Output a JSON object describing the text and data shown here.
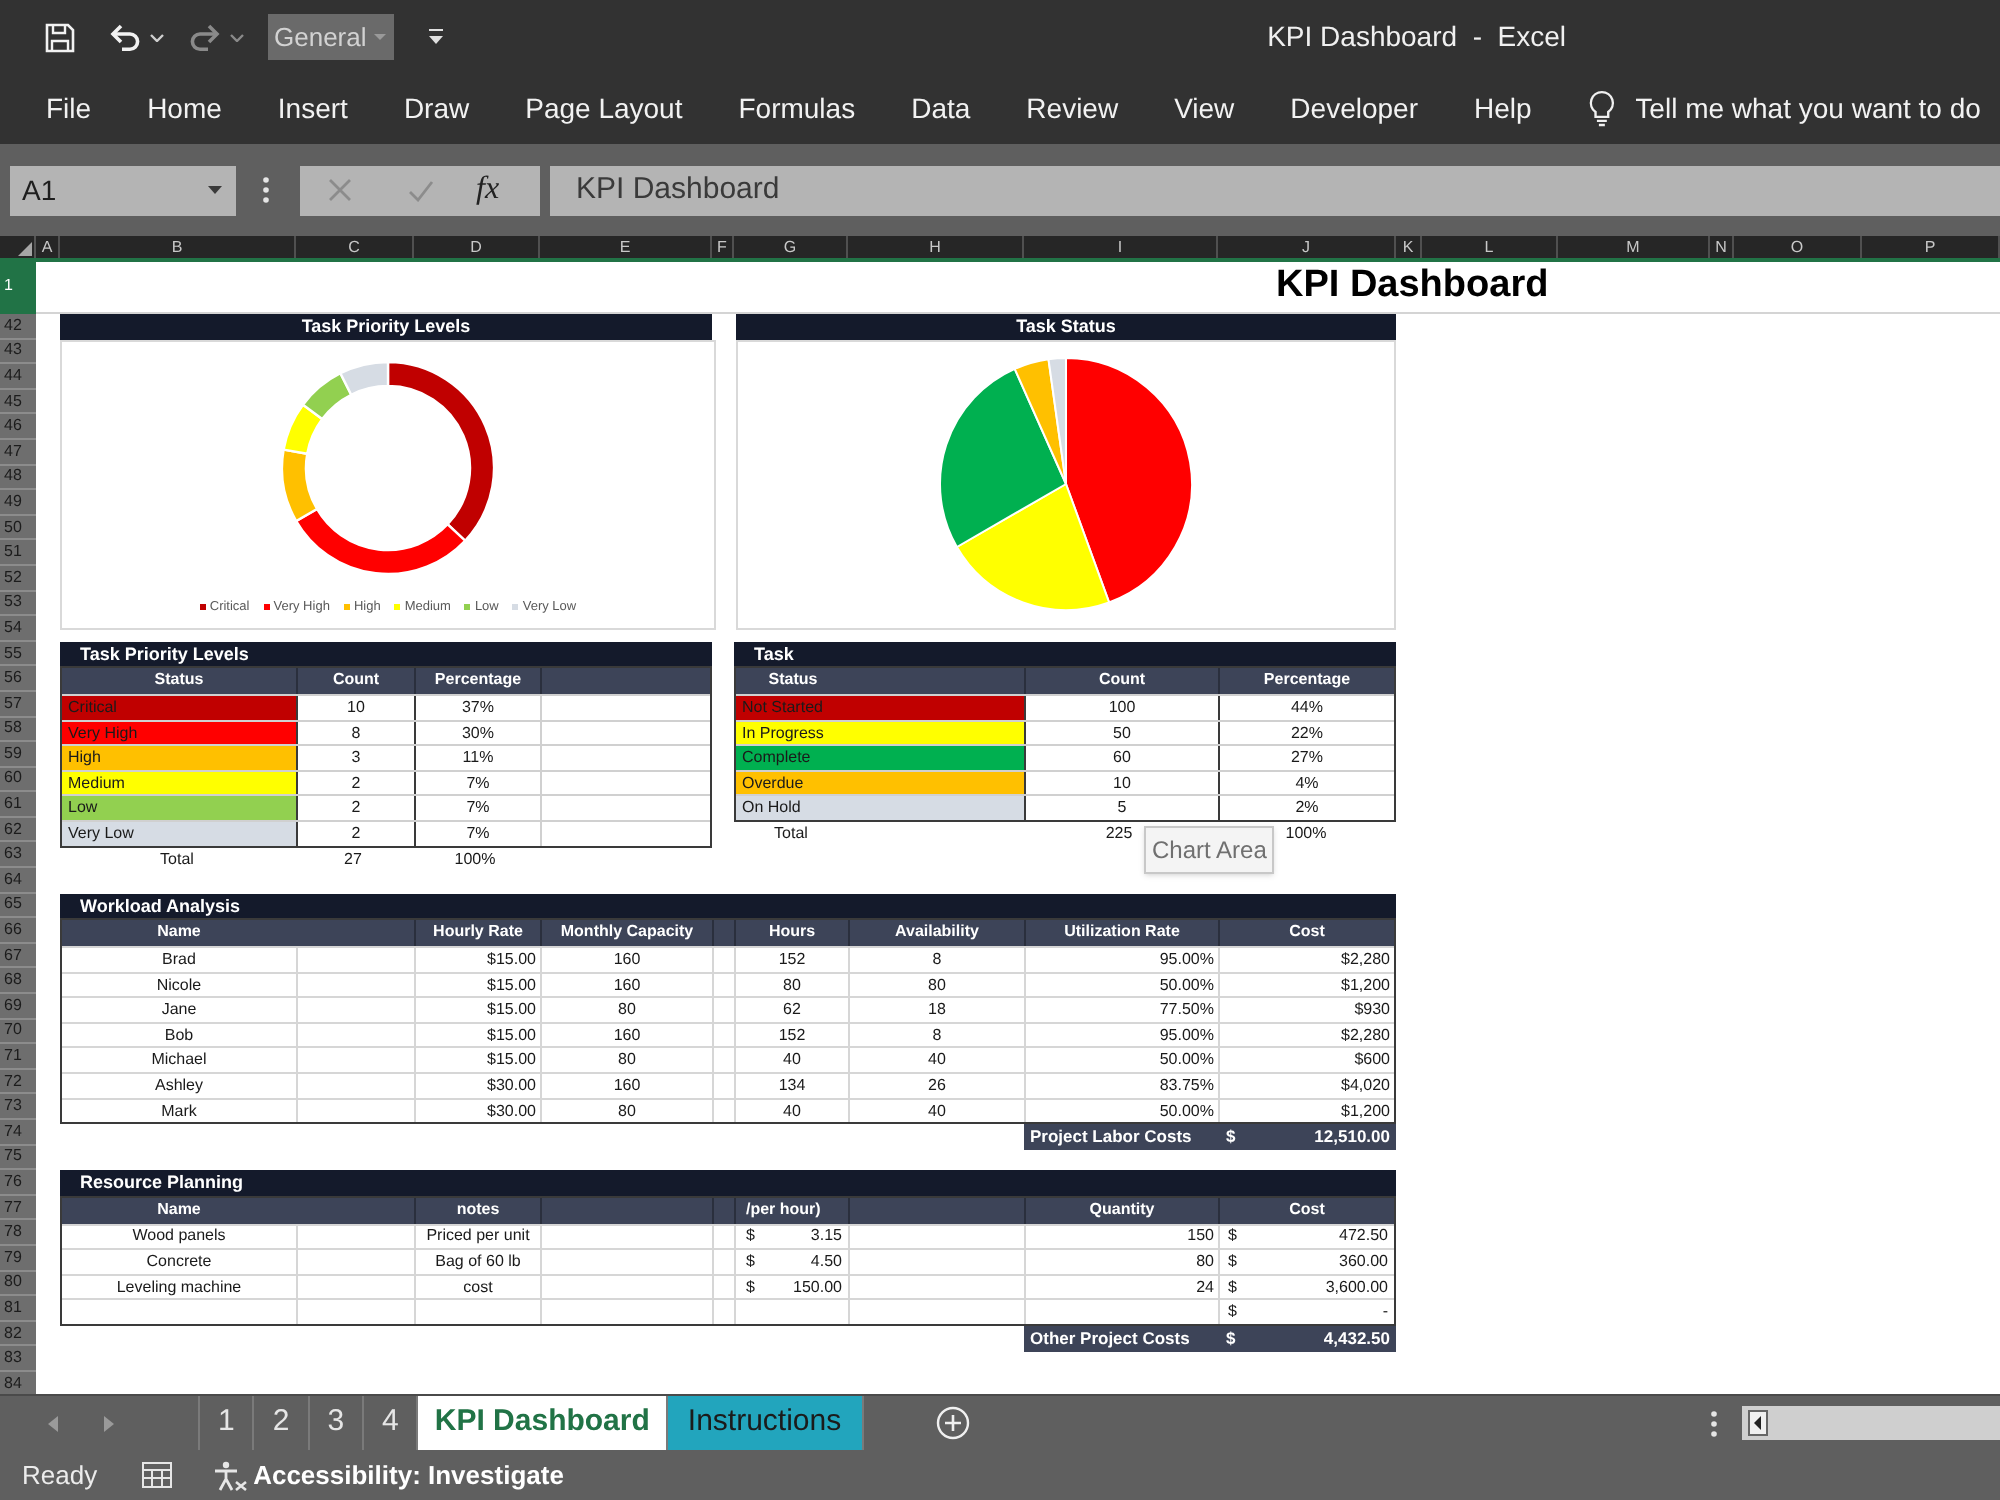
{
  "quick_access": {
    "number_format": "General"
  },
  "window": {
    "title": "KPI Dashboard  -  Excel"
  },
  "menu": [
    "File",
    "Home",
    "Insert",
    "Draw",
    "Page Layout",
    "Formulas",
    "Data",
    "Review",
    "View",
    "Developer",
    "Help"
  ],
  "tell_me": {
    "placeholder": "Tell me what you want to do"
  },
  "formula_bar": {
    "name_box": "A1",
    "function_label": "fx",
    "value": "KPI Dashboard"
  },
  "columns": [
    "A",
    "B",
    "C",
    "D",
    "E",
    "F",
    "G",
    "H",
    "I",
    "J",
    "K",
    "L",
    "M",
    "N",
    "O",
    "P"
  ],
  "row_headers": [
    {
      "label": "1",
      "selected": true
    },
    {
      "label": "42",
      "selected": false
    },
    {
      "label": "43",
      "selected": false
    },
    {
      "label": "44",
      "selected": false
    },
    {
      "label": "45",
      "selected": false
    },
    {
      "label": "46",
      "selected": false
    },
    {
      "label": "47",
      "selected": false
    },
    {
      "label": "48",
      "selected": false
    },
    {
      "label": "49",
      "selected": false
    },
    {
      "label": "50",
      "selected": false
    },
    {
      "label": "51",
      "selected": false
    },
    {
      "label": "52",
      "selected": false
    },
    {
      "label": "53",
      "selected": false
    },
    {
      "label": "54",
      "selected": false
    },
    {
      "label": "55",
      "selected": false
    },
    {
      "label": "56",
      "selected": false
    },
    {
      "label": "57",
      "selected": false
    },
    {
      "label": "58",
      "selected": false
    },
    {
      "label": "59",
      "selected": false
    },
    {
      "label": "60",
      "selected": false
    },
    {
      "label": "61",
      "selected": false
    },
    {
      "label": "62",
      "selected": false
    },
    {
      "label": "63",
      "selected": false
    },
    {
      "label": "64",
      "selected": false
    },
    {
      "label": "65",
      "selected": false
    },
    {
      "label": "66",
      "selected": false
    },
    {
      "label": "67",
      "selected": false
    },
    {
      "label": "68",
      "selected": false
    },
    {
      "label": "69",
      "selected": false
    },
    {
      "label": "70",
      "selected": false
    },
    {
      "label": "71",
      "selected": false
    },
    {
      "label": "72",
      "selected": false
    },
    {
      "label": "73",
      "selected": false
    },
    {
      "label": "74",
      "selected": false
    },
    {
      "label": "75",
      "selected": false
    },
    {
      "label": "76",
      "selected": false
    },
    {
      "label": "77",
      "selected": false
    },
    {
      "label": "78",
      "selected": false
    },
    {
      "label": "79",
      "selected": false
    },
    {
      "label": "80",
      "selected": false
    },
    {
      "label": "81",
      "selected": false
    },
    {
      "label": "82",
      "selected": false
    },
    {
      "label": "83",
      "selected": false
    },
    {
      "label": "84",
      "selected": false
    }
  ],
  "sheet": {
    "title": "KPI Dashboard",
    "charts": [
      {
        "kind": "donut",
        "title": "Task Priority Levels",
        "legend": [
          {
            "label": "Critical",
            "color": "#c00000"
          },
          {
            "label": "Very High",
            "color": "#ff0000"
          },
          {
            "label": "High",
            "color": "#ffc000"
          },
          {
            "label": "Medium",
            "color": "#ffff00"
          },
          {
            "label": "Low",
            "color": "#92d050"
          },
          {
            "label": "Very Low",
            "color": "#d6dce4"
          }
        ]
      },
      {
        "kind": "pie",
        "title": "Task Status"
      }
    ],
    "priority_table": {
      "title": "Task Priority Levels",
      "columns": [
        "Status",
        "Count",
        "Percentage"
      ],
      "rows": [
        {
          "status": "Critical",
          "color": "#c00000",
          "count": "10",
          "percentage": "37%"
        },
        {
          "status": "Very High",
          "color": "#ff0000",
          "count": "8",
          "percentage": "30%"
        },
        {
          "status": "High",
          "color": "#ffc000",
          "count": "3",
          "percentage": "11%"
        },
        {
          "status": "Medium",
          "color": "#ffff00",
          "count": "2",
          "percentage": "7%"
        },
        {
          "status": "Low",
          "color": "#92d050",
          "count": "2",
          "percentage": "7%"
        },
        {
          "status": "Very Low",
          "color": "#d6dce4",
          "count": "2",
          "percentage": "7%"
        }
      ],
      "total": {
        "label": "Total",
        "count": "27",
        "percentage": "100%"
      }
    },
    "status_table": {
      "title": "Task",
      "columns": [
        "Status",
        "Count",
        "Percentage"
      ],
      "rows": [
        {
          "status": "Not Started",
          "color": "#c00000",
          "count": "100",
          "percentage": "44%"
        },
        {
          "status": "In Progress",
          "color": "#ffff00",
          "count": "50",
          "percentage": "22%"
        },
        {
          "status": "Complete",
          "color": "#00b050",
          "count": "60",
          "percentage": "27%"
        },
        {
          "status": "Overdue",
          "color": "#ffc000",
          "count": "10",
          "percentage": "4%"
        },
        {
          "status": "On Hold",
          "color": "#d6dce4",
          "count": "5",
          "percentage": "2%"
        }
      ],
      "total": {
        "label": "Total",
        "count": "225",
        "percentage": "100%"
      }
    },
    "workload": {
      "title": "Workload Analysis",
      "columns": [
        "Name",
        "Hourly Rate",
        "Monthly Capacity",
        "Hours",
        "Availability",
        "Utilization Rate",
        "Cost"
      ],
      "rows": [
        [
          "Brad",
          "$15.00",
          "160",
          "152",
          "8",
          "95.00%",
          "$2,280"
        ],
        [
          "Nicole",
          "$15.00",
          "160",
          "80",
          "80",
          "50.00%",
          "$1,200"
        ],
        [
          "Jane",
          "$15.00",
          "80",
          "62",
          "18",
          "77.50%",
          "$930"
        ],
        [
          "Bob",
          "$15.00",
          "160",
          "152",
          "8",
          "95.00%",
          "$2,280"
        ],
        [
          "Michael",
          "$15.00",
          "80",
          "40",
          "40",
          "50.00%",
          "$600"
        ],
        [
          "Ashley",
          "$30.00",
          "160",
          "134",
          "26",
          "83.75%",
          "$4,020"
        ],
        [
          "Mark",
          "$30.00",
          "80",
          "40",
          "40",
          "50.00%",
          "$1,200"
        ]
      ],
      "total": {
        "label": "Project Labor Costs",
        "currency": "$",
        "value": "12,510.00"
      }
    },
    "resources": {
      "title": "Resource Planning",
      "columns": [
        "Name",
        "notes",
        "/per hour)",
        "Quantity",
        "Cost"
      ],
      "rows": [
        {
          "name": "Wood panels",
          "notes": "Priced per unit",
          "price_currency": "$",
          "price": "3.15",
          "quantity": "150",
          "cost_currency": "$",
          "cost": "472.50"
        },
        {
          "name": "Concrete",
          "notes": "Bag of 60 lb",
          "price_currency": "$",
          "price": "4.50",
          "quantity": "80",
          "cost_currency": "$",
          "cost": "360.00"
        },
        {
          "name": "Leveling machine",
          "notes": "cost",
          "price_currency": "$",
          "price": "150.00",
          "quantity": "24",
          "cost_currency": "$",
          "cost": "3,600.00"
        },
        {
          "cost_currency": "$",
          "cost": "-"
        }
      ],
      "total": {
        "label": "Other Project Costs",
        "currency": "$",
        "value": "4,432.50"
      }
    }
  },
  "tooltip": {
    "text": "Chart Area"
  },
  "sheet_tabs": [
    {
      "label": "1",
      "selected": false
    },
    {
      "label": "2",
      "selected": false
    },
    {
      "label": "3",
      "selected": false
    },
    {
      "label": "4",
      "selected": false
    },
    {
      "label": "KPI Dashboard",
      "selected": true
    },
    {
      "label": "Instructions",
      "selected": false,
      "color": "#22a5bd"
    }
  ],
  "status_bar": {
    "mode": "Ready",
    "accessibility": "Accessibility: Investigate"
  }
}
